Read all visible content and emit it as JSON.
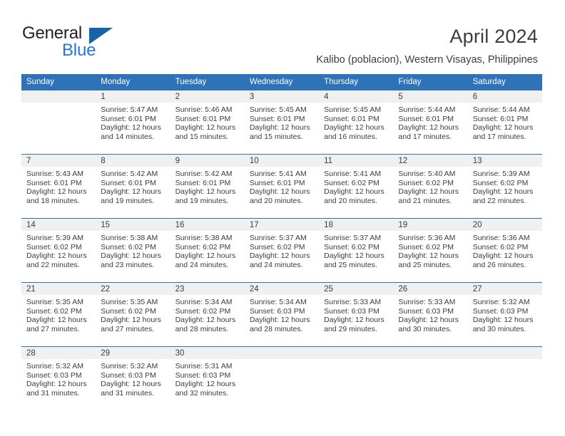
{
  "brand": {
    "name_part1": "General",
    "name_part2": "Blue",
    "accent_color": "#2175d9",
    "triangle_color": "#1763ab"
  },
  "header": {
    "title": "April 2024",
    "subtitle": "Kalibo (poblacion), Western Visayas, Philippines"
  },
  "calendar": {
    "header_bg": "#2e72b8",
    "daynum_bg": "#f0f0f0",
    "weekdays": [
      "Sunday",
      "Monday",
      "Tuesday",
      "Wednesday",
      "Thursday",
      "Friday",
      "Saturday"
    ],
    "weeks": [
      [
        {
          "day": "",
          "sunrise": "",
          "sunset": "",
          "daylight_line1": "",
          "daylight_line2": ""
        },
        {
          "day": "1",
          "sunrise": "Sunrise: 5:47 AM",
          "sunset": "Sunset: 6:01 PM",
          "daylight_line1": "Daylight: 12 hours",
          "daylight_line2": "and 14 minutes."
        },
        {
          "day": "2",
          "sunrise": "Sunrise: 5:46 AM",
          "sunset": "Sunset: 6:01 PM",
          "daylight_line1": "Daylight: 12 hours",
          "daylight_line2": "and 15 minutes."
        },
        {
          "day": "3",
          "sunrise": "Sunrise: 5:45 AM",
          "sunset": "Sunset: 6:01 PM",
          "daylight_line1": "Daylight: 12 hours",
          "daylight_line2": "and 15 minutes."
        },
        {
          "day": "4",
          "sunrise": "Sunrise: 5:45 AM",
          "sunset": "Sunset: 6:01 PM",
          "daylight_line1": "Daylight: 12 hours",
          "daylight_line2": "and 16 minutes."
        },
        {
          "day": "5",
          "sunrise": "Sunrise: 5:44 AM",
          "sunset": "Sunset: 6:01 PM",
          "daylight_line1": "Daylight: 12 hours",
          "daylight_line2": "and 17 minutes."
        },
        {
          "day": "6",
          "sunrise": "Sunrise: 5:44 AM",
          "sunset": "Sunset: 6:01 PM",
          "daylight_line1": "Daylight: 12 hours",
          "daylight_line2": "and 17 minutes."
        }
      ],
      [
        {
          "day": "7",
          "sunrise": "Sunrise: 5:43 AM",
          "sunset": "Sunset: 6:01 PM",
          "daylight_line1": "Daylight: 12 hours",
          "daylight_line2": "and 18 minutes."
        },
        {
          "day": "8",
          "sunrise": "Sunrise: 5:42 AM",
          "sunset": "Sunset: 6:01 PM",
          "daylight_line1": "Daylight: 12 hours",
          "daylight_line2": "and 19 minutes."
        },
        {
          "day": "9",
          "sunrise": "Sunrise: 5:42 AM",
          "sunset": "Sunset: 6:01 PM",
          "daylight_line1": "Daylight: 12 hours",
          "daylight_line2": "and 19 minutes."
        },
        {
          "day": "10",
          "sunrise": "Sunrise: 5:41 AM",
          "sunset": "Sunset: 6:01 PM",
          "daylight_line1": "Daylight: 12 hours",
          "daylight_line2": "and 20 minutes."
        },
        {
          "day": "11",
          "sunrise": "Sunrise: 5:41 AM",
          "sunset": "Sunset: 6:02 PM",
          "daylight_line1": "Daylight: 12 hours",
          "daylight_line2": "and 20 minutes."
        },
        {
          "day": "12",
          "sunrise": "Sunrise: 5:40 AM",
          "sunset": "Sunset: 6:02 PM",
          "daylight_line1": "Daylight: 12 hours",
          "daylight_line2": "and 21 minutes."
        },
        {
          "day": "13",
          "sunrise": "Sunrise: 5:39 AM",
          "sunset": "Sunset: 6:02 PM",
          "daylight_line1": "Daylight: 12 hours",
          "daylight_line2": "and 22 minutes."
        }
      ],
      [
        {
          "day": "14",
          "sunrise": "Sunrise: 5:39 AM",
          "sunset": "Sunset: 6:02 PM",
          "daylight_line1": "Daylight: 12 hours",
          "daylight_line2": "and 22 minutes."
        },
        {
          "day": "15",
          "sunrise": "Sunrise: 5:38 AM",
          "sunset": "Sunset: 6:02 PM",
          "daylight_line1": "Daylight: 12 hours",
          "daylight_line2": "and 23 minutes."
        },
        {
          "day": "16",
          "sunrise": "Sunrise: 5:38 AM",
          "sunset": "Sunset: 6:02 PM",
          "daylight_line1": "Daylight: 12 hours",
          "daylight_line2": "and 24 minutes."
        },
        {
          "day": "17",
          "sunrise": "Sunrise: 5:37 AM",
          "sunset": "Sunset: 6:02 PM",
          "daylight_line1": "Daylight: 12 hours",
          "daylight_line2": "and 24 minutes."
        },
        {
          "day": "18",
          "sunrise": "Sunrise: 5:37 AM",
          "sunset": "Sunset: 6:02 PM",
          "daylight_line1": "Daylight: 12 hours",
          "daylight_line2": "and 25 minutes."
        },
        {
          "day": "19",
          "sunrise": "Sunrise: 5:36 AM",
          "sunset": "Sunset: 6:02 PM",
          "daylight_line1": "Daylight: 12 hours",
          "daylight_line2": "and 25 minutes."
        },
        {
          "day": "20",
          "sunrise": "Sunrise: 5:36 AM",
          "sunset": "Sunset: 6:02 PM",
          "daylight_line1": "Daylight: 12 hours",
          "daylight_line2": "and 26 minutes."
        }
      ],
      [
        {
          "day": "21",
          "sunrise": "Sunrise: 5:35 AM",
          "sunset": "Sunset: 6:02 PM",
          "daylight_line1": "Daylight: 12 hours",
          "daylight_line2": "and 27 minutes."
        },
        {
          "day": "22",
          "sunrise": "Sunrise: 5:35 AM",
          "sunset": "Sunset: 6:02 PM",
          "daylight_line1": "Daylight: 12 hours",
          "daylight_line2": "and 27 minutes."
        },
        {
          "day": "23",
          "sunrise": "Sunrise: 5:34 AM",
          "sunset": "Sunset: 6:02 PM",
          "daylight_line1": "Daylight: 12 hours",
          "daylight_line2": "and 28 minutes."
        },
        {
          "day": "24",
          "sunrise": "Sunrise: 5:34 AM",
          "sunset": "Sunset: 6:03 PM",
          "daylight_line1": "Daylight: 12 hours",
          "daylight_line2": "and 28 minutes."
        },
        {
          "day": "25",
          "sunrise": "Sunrise: 5:33 AM",
          "sunset": "Sunset: 6:03 PM",
          "daylight_line1": "Daylight: 12 hours",
          "daylight_line2": "and 29 minutes."
        },
        {
          "day": "26",
          "sunrise": "Sunrise: 5:33 AM",
          "sunset": "Sunset: 6:03 PM",
          "daylight_line1": "Daylight: 12 hours",
          "daylight_line2": "and 30 minutes."
        },
        {
          "day": "27",
          "sunrise": "Sunrise: 5:32 AM",
          "sunset": "Sunset: 6:03 PM",
          "daylight_line1": "Daylight: 12 hours",
          "daylight_line2": "and 30 minutes."
        }
      ],
      [
        {
          "day": "28",
          "sunrise": "Sunrise: 5:32 AM",
          "sunset": "Sunset: 6:03 PM",
          "daylight_line1": "Daylight: 12 hours",
          "daylight_line2": "and 31 minutes."
        },
        {
          "day": "29",
          "sunrise": "Sunrise: 5:32 AM",
          "sunset": "Sunset: 6:03 PM",
          "daylight_line1": "Daylight: 12 hours",
          "daylight_line2": "and 31 minutes."
        },
        {
          "day": "30",
          "sunrise": "Sunrise: 5:31 AM",
          "sunset": "Sunset: 6:03 PM",
          "daylight_line1": "Daylight: 12 hours",
          "daylight_line2": "and 32 minutes."
        },
        {
          "day": "",
          "sunrise": "",
          "sunset": "",
          "daylight_line1": "",
          "daylight_line2": ""
        },
        {
          "day": "",
          "sunrise": "",
          "sunset": "",
          "daylight_line1": "",
          "daylight_line2": ""
        },
        {
          "day": "",
          "sunrise": "",
          "sunset": "",
          "daylight_line1": "",
          "daylight_line2": ""
        },
        {
          "day": "",
          "sunrise": "",
          "sunset": "",
          "daylight_line1": "",
          "daylight_line2": ""
        }
      ]
    ]
  }
}
